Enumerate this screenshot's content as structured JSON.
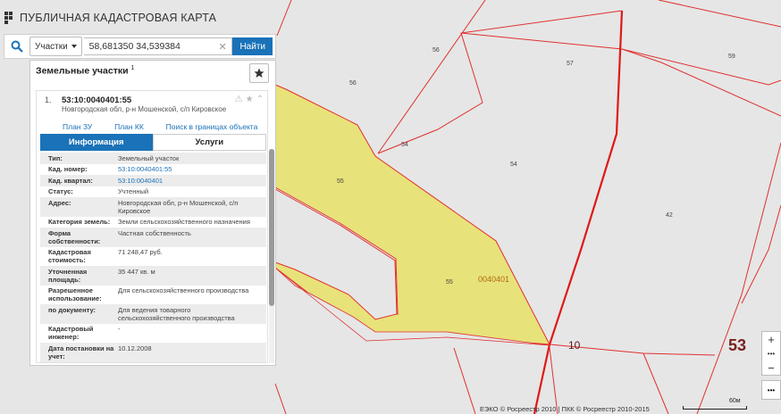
{
  "app": {
    "title": "ПУБЛИЧНАЯ КАДАСТРОВАЯ КАРТА"
  },
  "search": {
    "type_label": "Участки",
    "value": "58,681350 34,539384",
    "button": "Найти"
  },
  "panel": {
    "title": "Земельные участки",
    "title_count": "1"
  },
  "card": {
    "index": "1.",
    "cad_number": "53:10:0040401:55",
    "address": "Новгородская обл, р-н Мошенской, с/п Кировское",
    "links": [
      "План ЗУ →",
      "План КК →",
      "Поиск в границах объекта →"
    ],
    "tabs": {
      "info": "Информация",
      "services": "Услуги"
    },
    "rows": [
      {
        "k": "Тип:",
        "v": "Земельный участок"
      },
      {
        "k": "Кад. номер:",
        "v": "53:10:0040401:55"
      },
      {
        "k": "Кад. квартал:",
        "v": "53:10:0040401"
      },
      {
        "k": "Статус:",
        "v": "Учтенный"
      },
      {
        "k": "Адрес:",
        "v": "Новгородская обл, р-н Мошенской, с/п Кировское"
      },
      {
        "k": "Категория земель:",
        "v": "Земли сельскохозяйственного назначения"
      },
      {
        "k": "Форма собственности:",
        "v": "Частная собственность"
      },
      {
        "k": "Кадастровая стоимость:",
        "v": "71 248,47 руб."
      },
      {
        "k": "Уточненная площадь:",
        "v": "35 447 кв. м"
      },
      {
        "k": "Разрешенное использование:",
        "v": "Для сельскохозяйственного производства"
      },
      {
        "k": "по документу:",
        "v": "Для ведения товарного сельскохозяйственного производства"
      },
      {
        "k": "Кадастровый инженер:",
        "v": "-"
      },
      {
        "k": "Дата постановки на учет:",
        "v": "10.12.2008"
      }
    ]
  },
  "map": {
    "labels": [
      "56",
      "56",
      "57",
      "59",
      "54",
      "54",
      "55",
      "55",
      "42",
      "0040401"
    ],
    "big_label": "53",
    "quarter_label": "10",
    "zoom_in": "+",
    "zoom_mid": "•••",
    "zoom_out": "−",
    "more": "•••",
    "attribution": "ЕЭКО © Росреестр 2010 | ПКК © Росреестр 2010-2015",
    "scale": "60м"
  },
  "colors": {
    "accent": "#1a72b8",
    "parcel_fill": "#e8e27a",
    "boundary": "#e03030",
    "map_bg": "#e6e6e6"
  }
}
